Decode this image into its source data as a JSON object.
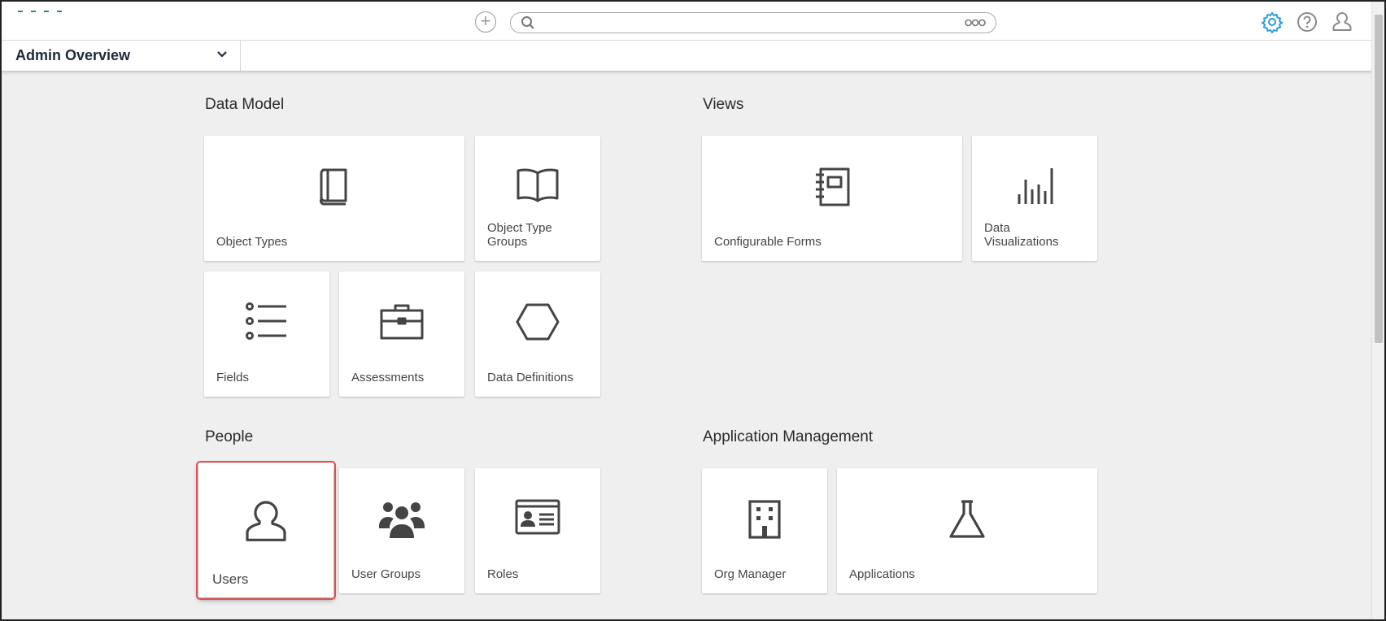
{
  "header": {
    "search": {
      "placeholder": ""
    },
    "colors": {
      "gear_accent": "#2a9fd6",
      "icon_gray": "#888888",
      "highlight": "#e05050"
    }
  },
  "subheader": {
    "view_title": "Admin Overview"
  },
  "sections": {
    "data_model": {
      "title": "Data Model",
      "tiles": [
        {
          "label": "Object Types",
          "icon": "book-icon"
        },
        {
          "label": "Object Type Groups",
          "icon": "open-book-icon"
        },
        {
          "label": "Fields",
          "icon": "list-icon"
        },
        {
          "label": "Assessments",
          "icon": "briefcase-icon"
        },
        {
          "label": "Data Definitions",
          "icon": "hexagon-icon"
        }
      ]
    },
    "views": {
      "title": "Views",
      "tiles": [
        {
          "label": "Configurable Forms",
          "icon": "notebook-icon"
        },
        {
          "label": "Data Visualizations",
          "icon": "bar-chart-icon"
        }
      ]
    },
    "people": {
      "title": "People",
      "tiles": [
        {
          "label": "Users",
          "icon": "user-icon"
        },
        {
          "label": "User Groups",
          "icon": "users-group-icon"
        },
        {
          "label": "Roles",
          "icon": "id-card-icon"
        }
      ]
    },
    "app_mgmt": {
      "title": "Application Management",
      "tiles": [
        {
          "label": "Org Manager",
          "icon": "building-icon"
        },
        {
          "label": "Applications",
          "icon": "flask-icon"
        }
      ]
    }
  }
}
